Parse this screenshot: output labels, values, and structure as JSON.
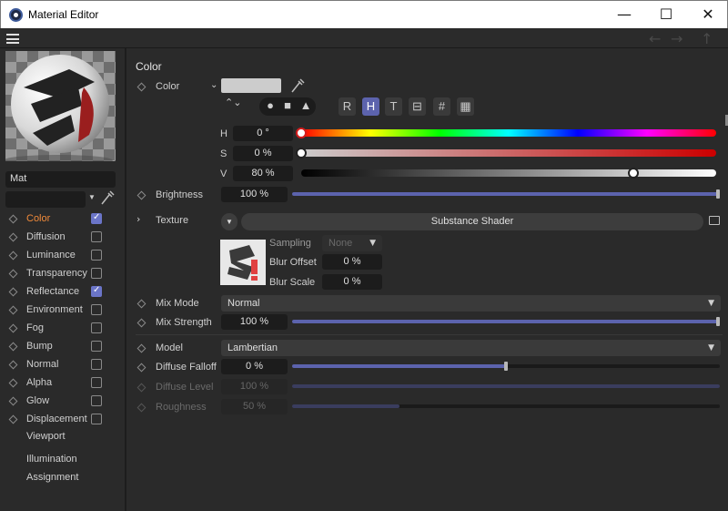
{
  "window": {
    "title": "Material Editor",
    "minimize_icon": "minimize-icon",
    "maximize_icon": "maximize-icon",
    "close_icon": "close-icon"
  },
  "window_controls": {
    "minimize": "—",
    "maximize": "☐",
    "close": "✕"
  },
  "toolbar": {
    "back": "←",
    "forward": "→",
    "up": "↑"
  },
  "material": {
    "name": "Mat"
  },
  "channels": [
    {
      "label": "Color",
      "checked": true,
      "active": true
    },
    {
      "label": "Diffusion",
      "checked": false
    },
    {
      "label": "Luminance",
      "checked": false
    },
    {
      "label": "Transparency",
      "checked": false
    },
    {
      "label": "Reflectance",
      "checked": true
    },
    {
      "label": "Environment",
      "checked": false
    },
    {
      "label": "Fog",
      "checked": false
    },
    {
      "label": "Bump",
      "checked": false
    },
    {
      "label": "Normal",
      "checked": false
    },
    {
      "label": "Alpha",
      "checked": false
    },
    {
      "label": "Glow",
      "checked": false
    },
    {
      "label": "Displacement",
      "checked": false
    }
  ],
  "extra_items": [
    "Viewport",
    "Illumination",
    "Assignment"
  ],
  "color_section": {
    "title": "Color",
    "color_label": "Color",
    "swatch_color": "#cccccc",
    "mode_letters": [
      "R",
      "H",
      "T",
      "⊟",
      "#",
      "▦"
    ],
    "selected_mode": "H",
    "h_label": "H",
    "h_value": "0 °",
    "h_fraction": 0.0,
    "s_label": "S",
    "s_value": "0 %",
    "s_fraction": 0.0,
    "v_label": "V",
    "v_value": "80 %",
    "v_fraction": 0.8,
    "brightness_label": "Brightness",
    "brightness_value": "100 %",
    "brightness_fraction": 1.0,
    "texture_label": "Texture",
    "shader_name": "Substance Shader",
    "sampling_label": "Sampling",
    "sampling_value": "None",
    "blur_offset_label": "Blur Offset",
    "blur_offset_value": "0 %",
    "blur_scale_label": "Blur Scale",
    "blur_scale_value": "0 %",
    "mix_mode_label": "Mix Mode",
    "mix_mode_value": "Normal",
    "mix_strength_label": "Mix Strength",
    "mix_strength_value": "100 %",
    "mix_strength_fraction": 1.0,
    "model_label": "Model",
    "model_value": "Lambertian",
    "diffuse_falloff_label": "Diffuse Falloff",
    "diffuse_falloff_value": "0 %",
    "diffuse_falloff_fraction": 0.5,
    "diffuse_level_label": "Diffuse Level",
    "diffuse_level_value": "100 %",
    "diffuse_level_fraction": 1.0,
    "roughness_label": "Roughness",
    "roughness_value": "50 %",
    "roughness_fraction": 0.25
  },
  "colors": {
    "accent": "#5c63ad",
    "active_channel": "#f08a3a",
    "background": "#2a2a2a"
  }
}
